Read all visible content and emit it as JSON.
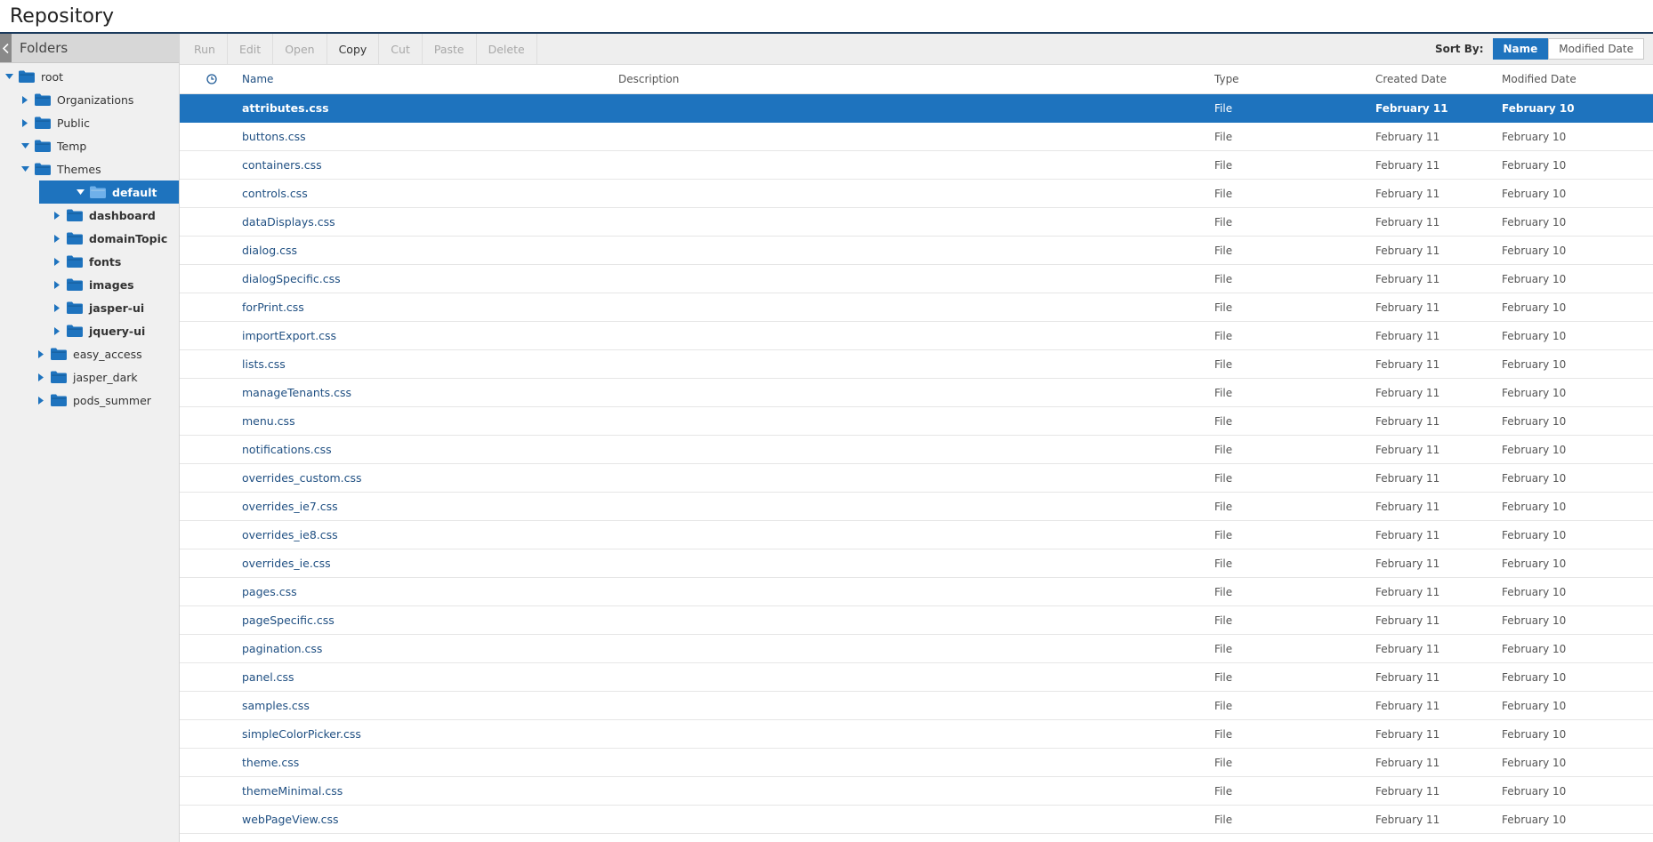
{
  "app": {
    "title": "Repository"
  },
  "folders_panel": {
    "title": "Folders",
    "tree": [
      {
        "label": "root",
        "depth": 0,
        "expanded": true,
        "arrow": "down",
        "bold": false,
        "selected": false
      },
      {
        "label": "Organizations",
        "depth": 1,
        "arrow": "right",
        "bold": false,
        "selected": false
      },
      {
        "label": "Public",
        "depth": 1,
        "arrow": "right",
        "bold": false,
        "selected": false
      },
      {
        "label": "Temp",
        "depth": 1,
        "arrow": "down",
        "bold": false,
        "selected": false
      },
      {
        "label": "Themes",
        "depth": 1,
        "arrow": "down",
        "bold": false,
        "selected": false
      },
      {
        "label": "default",
        "depth": 2,
        "arrow": "down",
        "bold": true,
        "selected": true
      },
      {
        "label": "dashboard",
        "depth": 3,
        "arrow": "right",
        "bold": true,
        "selected": false
      },
      {
        "label": "domainTopic",
        "depth": 3,
        "arrow": "right",
        "bold": true,
        "selected": false
      },
      {
        "label": "fonts",
        "depth": 3,
        "arrow": "right",
        "bold": true,
        "selected": false
      },
      {
        "label": "images",
        "depth": 3,
        "arrow": "right",
        "bold": true,
        "selected": false
      },
      {
        "label": "jasper-ui",
        "depth": 3,
        "arrow": "right",
        "bold": true,
        "selected": false
      },
      {
        "label": "jquery-ui",
        "depth": 3,
        "arrow": "right",
        "bold": true,
        "selected": false
      },
      {
        "label": "easy_access",
        "depth": 2,
        "arrow": "right",
        "bold": false,
        "selected": false
      },
      {
        "label": "jasper_dark",
        "depth": 2,
        "arrow": "right",
        "bold": false,
        "selected": false
      },
      {
        "label": "pods_summer",
        "depth": 2,
        "arrow": "right",
        "bold": false,
        "selected": false
      }
    ]
  },
  "toolbar": {
    "buttons": [
      {
        "label": "Run",
        "enabled": false
      },
      {
        "label": "Edit",
        "enabled": false
      },
      {
        "label": "Open",
        "enabled": false
      },
      {
        "label": "Copy",
        "enabled": true
      },
      {
        "label": "Cut",
        "enabled": false
      },
      {
        "label": "Paste",
        "enabled": false
      },
      {
        "label": "Delete",
        "enabled": false
      }
    ],
    "sort_label": "Sort By:",
    "sort_options": [
      {
        "label": "Name",
        "active": true
      },
      {
        "label": "Modified Date",
        "active": false
      }
    ]
  },
  "table": {
    "columns": {
      "name": "Name",
      "description": "Description",
      "type": "Type",
      "created": "Created Date",
      "modified": "Modified Date"
    },
    "rows": [
      {
        "name": "attributes.css",
        "description": "",
        "type": "File",
        "created": "February 11",
        "modified": "February 10",
        "selected": true
      },
      {
        "name": "buttons.css",
        "description": "",
        "type": "File",
        "created": "February 11",
        "modified": "February 10"
      },
      {
        "name": "containers.css",
        "description": "",
        "type": "File",
        "created": "February 11",
        "modified": "February 10"
      },
      {
        "name": "controls.css",
        "description": "",
        "type": "File",
        "created": "February 11",
        "modified": "February 10"
      },
      {
        "name": "dataDisplays.css",
        "description": "",
        "type": "File",
        "created": "February 11",
        "modified": "February 10"
      },
      {
        "name": "dialog.css",
        "description": "",
        "type": "File",
        "created": "February 11",
        "modified": "February 10"
      },
      {
        "name": "dialogSpecific.css",
        "description": "",
        "type": "File",
        "created": "February 11",
        "modified": "February 10"
      },
      {
        "name": "forPrint.css",
        "description": "",
        "type": "File",
        "created": "February 11",
        "modified": "February 10"
      },
      {
        "name": "importExport.css",
        "description": "",
        "type": "File",
        "created": "February 11",
        "modified": "February 10"
      },
      {
        "name": "lists.css",
        "description": "",
        "type": "File",
        "created": "February 11",
        "modified": "February 10"
      },
      {
        "name": "manageTenants.css",
        "description": "",
        "type": "File",
        "created": "February 11",
        "modified": "February 10"
      },
      {
        "name": "menu.css",
        "description": "",
        "type": "File",
        "created": "February 11",
        "modified": "February 10"
      },
      {
        "name": "notifications.css",
        "description": "",
        "type": "File",
        "created": "February 11",
        "modified": "February 10"
      },
      {
        "name": "overrides_custom.css",
        "description": "",
        "type": "File",
        "created": "February 11",
        "modified": "February 10"
      },
      {
        "name": "overrides_ie7.css",
        "description": "",
        "type": "File",
        "created": "February 11",
        "modified": "February 10"
      },
      {
        "name": "overrides_ie8.css",
        "description": "",
        "type": "File",
        "created": "February 11",
        "modified": "February 10"
      },
      {
        "name": "overrides_ie.css",
        "description": "",
        "type": "File",
        "created": "February 11",
        "modified": "February 10"
      },
      {
        "name": "pages.css",
        "description": "",
        "type": "File",
        "created": "February 11",
        "modified": "February 10"
      },
      {
        "name": "pageSpecific.css",
        "description": "",
        "type": "File",
        "created": "February 11",
        "modified": "February 10"
      },
      {
        "name": "pagination.css",
        "description": "",
        "type": "File",
        "created": "February 11",
        "modified": "February 10"
      },
      {
        "name": "panel.css",
        "description": "",
        "type": "File",
        "created": "February 11",
        "modified": "February 10"
      },
      {
        "name": "samples.css",
        "description": "",
        "type": "File",
        "created": "February 11",
        "modified": "February 10"
      },
      {
        "name": "simpleColorPicker.css",
        "description": "",
        "type": "File",
        "created": "February 11",
        "modified": "February 10"
      },
      {
        "name": "theme.css",
        "description": "",
        "type": "File",
        "created": "February 11",
        "modified": "February 10"
      },
      {
        "name": "themeMinimal.css",
        "description": "",
        "type": "File",
        "created": "February 11",
        "modified": "February 10"
      },
      {
        "name": "webPageView.css",
        "description": "",
        "type": "File",
        "created": "February 11",
        "modified": "February 10"
      }
    ]
  },
  "colors": {
    "accent": "#1e73be",
    "header_rule": "#1b3a5c",
    "link": "#1f4f82",
    "folder": "#1e73be"
  },
  "icons": {
    "collapse": "chevron-left-icon",
    "folder": "folder-icon",
    "expand": "triangle-right-icon",
    "collapse_node": "triangle-down-icon",
    "column_chooser": "clock-icon"
  }
}
